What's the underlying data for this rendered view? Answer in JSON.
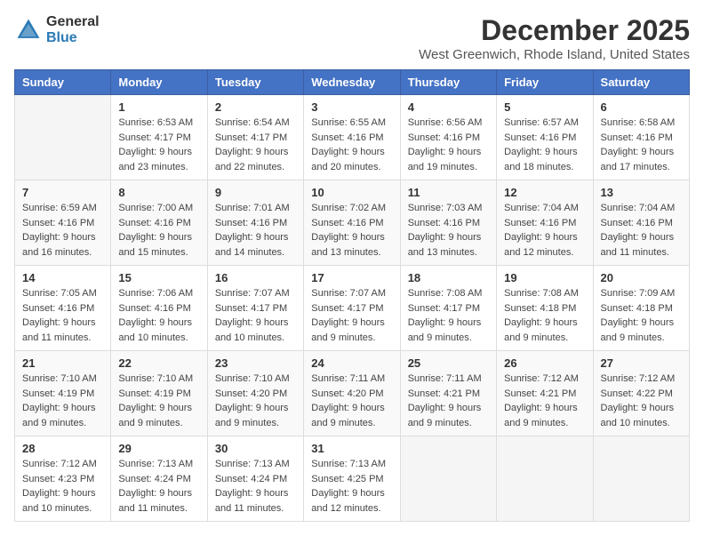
{
  "logo": {
    "line1": "General",
    "line2": "Blue"
  },
  "title": "December 2025",
  "subtitle": "West Greenwich, Rhode Island, United States",
  "weekdays": [
    "Sunday",
    "Monday",
    "Tuesday",
    "Wednesday",
    "Thursday",
    "Friday",
    "Saturday"
  ],
  "weeks": [
    [
      {
        "day": "",
        "sunrise": "",
        "sunset": "",
        "daylight": ""
      },
      {
        "day": "1",
        "sunrise": "Sunrise: 6:53 AM",
        "sunset": "Sunset: 4:17 PM",
        "daylight": "Daylight: 9 hours and 23 minutes."
      },
      {
        "day": "2",
        "sunrise": "Sunrise: 6:54 AM",
        "sunset": "Sunset: 4:17 PM",
        "daylight": "Daylight: 9 hours and 22 minutes."
      },
      {
        "day": "3",
        "sunrise": "Sunrise: 6:55 AM",
        "sunset": "Sunset: 4:16 PM",
        "daylight": "Daylight: 9 hours and 20 minutes."
      },
      {
        "day": "4",
        "sunrise": "Sunrise: 6:56 AM",
        "sunset": "Sunset: 4:16 PM",
        "daylight": "Daylight: 9 hours and 19 minutes."
      },
      {
        "day": "5",
        "sunrise": "Sunrise: 6:57 AM",
        "sunset": "Sunset: 4:16 PM",
        "daylight": "Daylight: 9 hours and 18 minutes."
      },
      {
        "day": "6",
        "sunrise": "Sunrise: 6:58 AM",
        "sunset": "Sunset: 4:16 PM",
        "daylight": "Daylight: 9 hours and 17 minutes."
      }
    ],
    [
      {
        "day": "7",
        "sunrise": "Sunrise: 6:59 AM",
        "sunset": "Sunset: 4:16 PM",
        "daylight": "Daylight: 9 hours and 16 minutes."
      },
      {
        "day": "8",
        "sunrise": "Sunrise: 7:00 AM",
        "sunset": "Sunset: 4:16 PM",
        "daylight": "Daylight: 9 hours and 15 minutes."
      },
      {
        "day": "9",
        "sunrise": "Sunrise: 7:01 AM",
        "sunset": "Sunset: 4:16 PM",
        "daylight": "Daylight: 9 hours and 14 minutes."
      },
      {
        "day": "10",
        "sunrise": "Sunrise: 7:02 AM",
        "sunset": "Sunset: 4:16 PM",
        "daylight": "Daylight: 9 hours and 13 minutes."
      },
      {
        "day": "11",
        "sunrise": "Sunrise: 7:03 AM",
        "sunset": "Sunset: 4:16 PM",
        "daylight": "Daylight: 9 hours and 13 minutes."
      },
      {
        "day": "12",
        "sunrise": "Sunrise: 7:04 AM",
        "sunset": "Sunset: 4:16 PM",
        "daylight": "Daylight: 9 hours and 12 minutes."
      },
      {
        "day": "13",
        "sunrise": "Sunrise: 7:04 AM",
        "sunset": "Sunset: 4:16 PM",
        "daylight": "Daylight: 9 hours and 11 minutes."
      }
    ],
    [
      {
        "day": "14",
        "sunrise": "Sunrise: 7:05 AM",
        "sunset": "Sunset: 4:16 PM",
        "daylight": "Daylight: 9 hours and 11 minutes."
      },
      {
        "day": "15",
        "sunrise": "Sunrise: 7:06 AM",
        "sunset": "Sunset: 4:16 PM",
        "daylight": "Daylight: 9 hours and 10 minutes."
      },
      {
        "day": "16",
        "sunrise": "Sunrise: 7:07 AM",
        "sunset": "Sunset: 4:17 PM",
        "daylight": "Daylight: 9 hours and 10 minutes."
      },
      {
        "day": "17",
        "sunrise": "Sunrise: 7:07 AM",
        "sunset": "Sunset: 4:17 PM",
        "daylight": "Daylight: 9 hours and 9 minutes."
      },
      {
        "day": "18",
        "sunrise": "Sunrise: 7:08 AM",
        "sunset": "Sunset: 4:17 PM",
        "daylight": "Daylight: 9 hours and 9 minutes."
      },
      {
        "day": "19",
        "sunrise": "Sunrise: 7:08 AM",
        "sunset": "Sunset: 4:18 PM",
        "daylight": "Daylight: 9 hours and 9 minutes."
      },
      {
        "day": "20",
        "sunrise": "Sunrise: 7:09 AM",
        "sunset": "Sunset: 4:18 PM",
        "daylight": "Daylight: 9 hours and 9 minutes."
      }
    ],
    [
      {
        "day": "21",
        "sunrise": "Sunrise: 7:10 AM",
        "sunset": "Sunset: 4:19 PM",
        "daylight": "Daylight: 9 hours and 9 minutes."
      },
      {
        "day": "22",
        "sunrise": "Sunrise: 7:10 AM",
        "sunset": "Sunset: 4:19 PM",
        "daylight": "Daylight: 9 hours and 9 minutes."
      },
      {
        "day": "23",
        "sunrise": "Sunrise: 7:10 AM",
        "sunset": "Sunset: 4:20 PM",
        "daylight": "Daylight: 9 hours and 9 minutes."
      },
      {
        "day": "24",
        "sunrise": "Sunrise: 7:11 AM",
        "sunset": "Sunset: 4:20 PM",
        "daylight": "Daylight: 9 hours and 9 minutes."
      },
      {
        "day": "25",
        "sunrise": "Sunrise: 7:11 AM",
        "sunset": "Sunset: 4:21 PM",
        "daylight": "Daylight: 9 hours and 9 minutes."
      },
      {
        "day": "26",
        "sunrise": "Sunrise: 7:12 AM",
        "sunset": "Sunset: 4:21 PM",
        "daylight": "Daylight: 9 hours and 9 minutes."
      },
      {
        "day": "27",
        "sunrise": "Sunrise: 7:12 AM",
        "sunset": "Sunset: 4:22 PM",
        "daylight": "Daylight: 9 hours and 10 minutes."
      }
    ],
    [
      {
        "day": "28",
        "sunrise": "Sunrise: 7:12 AM",
        "sunset": "Sunset: 4:23 PM",
        "daylight": "Daylight: 9 hours and 10 minutes."
      },
      {
        "day": "29",
        "sunrise": "Sunrise: 7:13 AM",
        "sunset": "Sunset: 4:24 PM",
        "daylight": "Daylight: 9 hours and 11 minutes."
      },
      {
        "day": "30",
        "sunrise": "Sunrise: 7:13 AM",
        "sunset": "Sunset: 4:24 PM",
        "daylight": "Daylight: 9 hours and 11 minutes."
      },
      {
        "day": "31",
        "sunrise": "Sunrise: 7:13 AM",
        "sunset": "Sunset: 4:25 PM",
        "daylight": "Daylight: 9 hours and 12 minutes."
      },
      {
        "day": "",
        "sunrise": "",
        "sunset": "",
        "daylight": ""
      },
      {
        "day": "",
        "sunrise": "",
        "sunset": "",
        "daylight": ""
      },
      {
        "day": "",
        "sunrise": "",
        "sunset": "",
        "daylight": ""
      }
    ]
  ]
}
